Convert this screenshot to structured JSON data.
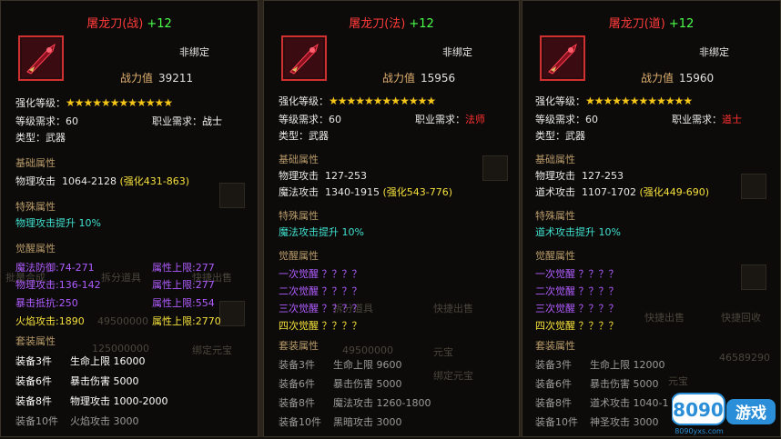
{
  "panels": [
    {
      "title": "屠龙刀(战)",
      "plus": "+12",
      "bind": "非绑定",
      "power_label": "战力值",
      "power": "39211",
      "enhance_label": "强化等级：",
      "stars": "★★★★★★★★★★★★",
      "level_req": "等级需求：60",
      "job_label": "职业需求：",
      "job": "战士",
      "type": "类型：武器",
      "base_header": "基础属性",
      "base": [
        {
          "label": "物理攻击",
          "value": "1064-2128",
          "bonus": "(强化431-863)"
        }
      ],
      "special_header": "特殊属性",
      "special": "物理攻击提升  10%",
      "awaken_header": "觉醒属性",
      "awaken": [
        {
          "l": "魔法防御:74-271",
          "r": "属性上限:277"
        },
        {
          "l": "物理攻击:136-142",
          "r": "属性上限:277"
        },
        {
          "l": "暴击抵抗:250",
          "r": "属性上限:554"
        },
        {
          "l": "火焰攻击:1890",
          "r": "属性上限:2770"
        }
      ],
      "set_header": "套装属性",
      "set": [
        {
          "pieces": "装备3件",
          "stat": "生命上限 16000"
        },
        {
          "pieces": "装备6件",
          "stat": "暴击伤害 5000"
        },
        {
          "pieces": "装备8件",
          "stat": "物理攻击 1000-2000"
        },
        {
          "pieces": "装备10件",
          "stat": "火焰攻击 3000"
        }
      ]
    },
    {
      "title": "屠龙刀(法)",
      "plus": "+12",
      "bind": "非绑定",
      "power_label": "战力值",
      "power": "15956",
      "enhance_label": "强化等级：",
      "stars": "★★★★★★★★★★★★",
      "level_req": "等级需求：60",
      "job_label": "职业需求：",
      "job": "法师",
      "type": "类型：武器",
      "base_header": "基础属性",
      "base": [
        {
          "label": "物理攻击",
          "value": "127-253",
          "bonus": ""
        },
        {
          "label": "魔法攻击",
          "value": "1340-1915",
          "bonus": "(强化543-776)"
        }
      ],
      "special_header": "特殊属性",
      "special": "魔法攻击提升  10%",
      "awaken_header": "觉醒属性",
      "awaken": [
        "一次觉醒 ？？？？",
        "二次觉醒 ？？？？",
        "三次觉醒 ？？？？",
        "四次觉醒 ？？？？"
      ],
      "set_header": "套装属性",
      "set": [
        {
          "pieces": "装备3件",
          "stat": "生命上限 9600"
        },
        {
          "pieces": "装备6件",
          "stat": "暴击伤害 5000"
        },
        {
          "pieces": "装备8件",
          "stat": "魔法攻击 1260-1800"
        },
        {
          "pieces": "装备10件",
          "stat": "黑暗攻击 3000"
        }
      ]
    },
    {
      "title": "屠龙刀(道)",
      "plus": "+12",
      "bind": "非绑定",
      "power_label": "战力值",
      "power": "15960",
      "enhance_label": "强化等级：",
      "stars": "★★★★★★★★★★★★",
      "level_req": "等级需求：60",
      "job_label": "职业需求：",
      "job": "道士",
      "type": "类型：武器",
      "base_header": "基础属性",
      "base": [
        {
          "label": "物理攻击",
          "value": "127-253",
          "bonus": ""
        },
        {
          "label": "道术攻击",
          "value": "1107-1702",
          "bonus": "(强化449-690)"
        }
      ],
      "special_header": "特殊属性",
      "special": "道术攻击提升  10%",
      "awaken_header": "觉醒属性",
      "awaken": [
        "一次觉醒 ？？？？",
        "二次觉醒 ？？？？",
        "三次觉醒 ？？？？",
        "四次觉醒 ？？？？"
      ],
      "set_header": "套装属性",
      "set": [
        {
          "pieces": "装备3件",
          "stat": "生命上限 12000"
        },
        {
          "pieces": "装备6件",
          "stat": "暴击伤害 5000"
        },
        {
          "pieces": "装备8件",
          "stat": "道术攻击 1040-1"
        },
        {
          "pieces": "装备10件",
          "stat": "神圣攻击 3000"
        }
      ]
    }
  ],
  "background": {
    "btn_split": "拆分道具",
    "btn_sell": "快捷出售",
    "btn_recycle": "快捷回收",
    "btn_batch": "批量合成",
    "gold1": "49500000",
    "gold2": "125000000",
    "gold3": "49500000",
    "gold4": "46589290",
    "bound_label": "绑定元宝",
    "yuanbao": "元宝"
  },
  "watermark": {
    "brand": "8090",
    "tag": "游戏",
    "url": "8090yxs.com"
  }
}
